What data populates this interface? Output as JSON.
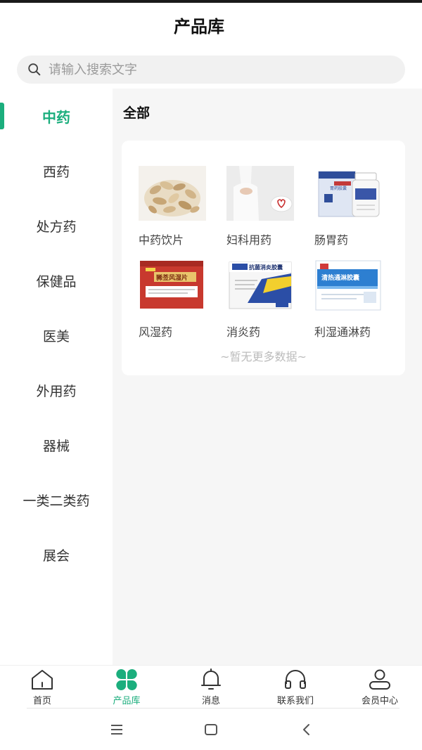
{
  "header": {
    "title": "产品库"
  },
  "search": {
    "placeholder": "请输入搜索文字"
  },
  "sidebar": {
    "items": [
      {
        "label": "中药",
        "active": true
      },
      {
        "label": "西药"
      },
      {
        "label": "处方药"
      },
      {
        "label": "保健品"
      },
      {
        "label": "医美"
      },
      {
        "label": "外用药"
      },
      {
        "label": "器械"
      },
      {
        "label": "一类二类药"
      },
      {
        "label": "展会"
      }
    ]
  },
  "main": {
    "section_title": "全部",
    "products": [
      {
        "label": "中药饮片"
      },
      {
        "label": "妇科用药"
      },
      {
        "label": "肠胃药",
        "pack_text": "胃药胶囊"
      },
      {
        "label": "风湿药",
        "pack_text": "豨莶风湿片"
      },
      {
        "label": "消炎药",
        "pack_text": "抗菌消炎胶囊"
      },
      {
        "label": "利湿通淋药",
        "pack_text": "清热通淋胶囊"
      }
    ],
    "no_more_text": "~暂无更多数据~"
  },
  "tabbar": {
    "items": [
      {
        "label": "首页",
        "icon": "home-icon"
      },
      {
        "label": "产品库",
        "icon": "clover-icon",
        "active": true
      },
      {
        "label": "消息",
        "icon": "bell-icon"
      },
      {
        "label": "联系我们",
        "icon": "headset-icon"
      },
      {
        "label": "会员中心",
        "icon": "user-icon"
      }
    ]
  },
  "colors": {
    "accent": "#1bae7d",
    "background": "#f6f6f6"
  }
}
